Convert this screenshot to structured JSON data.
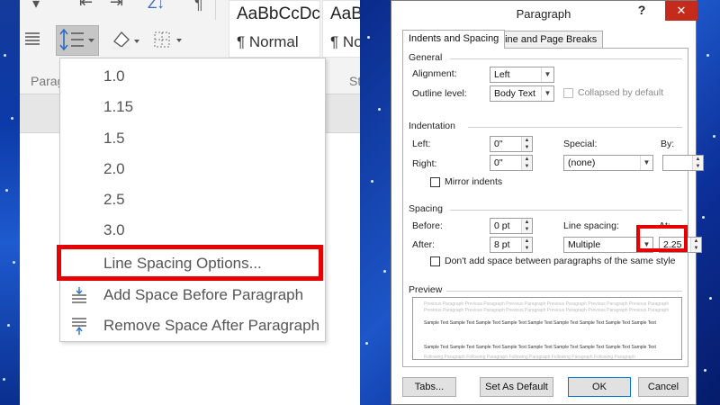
{
  "ribbon": {
    "style_normal_sample": "AaBbCcDc",
    "style_normal_name": "¶ Normal",
    "style_nospacing_sample": "AaBbCcDc",
    "style_nospacing_name": "¶ No",
    "paragraph_group_label": "Parag",
    "styles_group_label": "St"
  },
  "line_spacing_menu": {
    "items": [
      "1.0",
      "1.15",
      "1.5",
      "2.0",
      "2.5",
      "3.0"
    ],
    "options_label": "Line Spacing Options...",
    "add_space_before": "Add Space Before Paragraph",
    "remove_space_after": "Remove Space After Paragraph"
  },
  "dialog": {
    "title": "Paragraph",
    "help": "?",
    "close": "✕",
    "tabs": [
      "Indents and Spacing",
      "Line and Page Breaks"
    ],
    "general": {
      "heading": "General",
      "alignment_label": "Alignment:",
      "alignment_value": "Left",
      "outline_label": "Outline level:",
      "outline_value": "Body Text",
      "collapsed_label": "Collapsed by default"
    },
    "indentation": {
      "heading": "Indentation",
      "left_label": "Left:",
      "left_value": "0\"",
      "right_label": "Right:",
      "right_value": "0\"",
      "special_label": "Special:",
      "special_value": "(none)",
      "by_label": "By:",
      "by_value": "",
      "mirror_label": "Mirror indents"
    },
    "spacing": {
      "heading": "Spacing",
      "before_label": "Before:",
      "before_value": "0 pt",
      "after_label": "After:",
      "after_value": "8 pt",
      "line_spacing_label": "Line spacing:",
      "line_spacing_value": "Multiple",
      "at_label": "At:",
      "at_value": "2.25",
      "dont_add_label": "Don't add space between paragraphs of the same style"
    },
    "preview": {
      "heading": "Preview",
      "prev_text": "Previous Paragraph Previous Paragraph Previous Paragraph Previous Paragraph Previous Paragraph Previous Paragraph",
      "sample_text": "Sample Text Sample Text Sample Text Sample Text Sample Text Sample Text Sample Text Sample Text Sample Text",
      "next_text": "Following Paragraph Following Paragraph Following Paragraph Following Paragraph Following Paragraph"
    },
    "buttons": {
      "tabs": "Tabs...",
      "set_default": "Set As Default",
      "ok": "OK",
      "cancel": "Cancel"
    }
  },
  "colors": {
    "highlight": "#e60000",
    "close_red": "#c42b1c",
    "desktop_blue": "#1d56c8"
  }
}
